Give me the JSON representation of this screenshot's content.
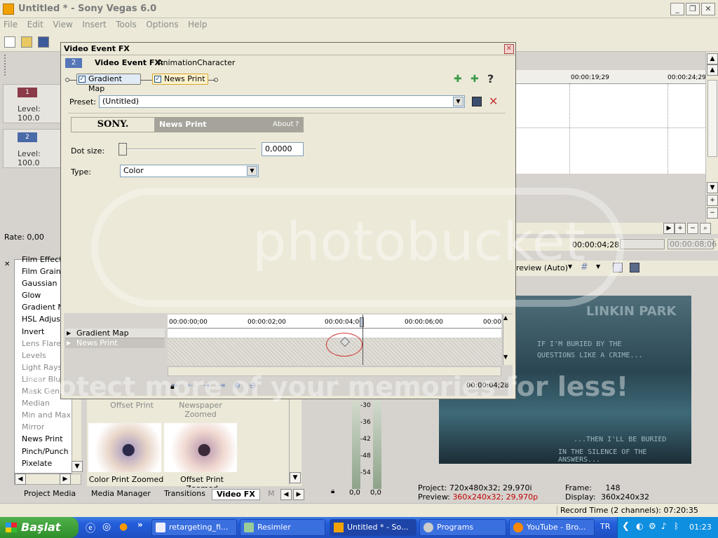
{
  "app": {
    "title": "Untitled * - Sony Vegas 6.0"
  },
  "menu": [
    "File",
    "Edit",
    "View",
    "Insert",
    "Tools",
    "Options",
    "Help"
  ],
  "tracks": [
    {
      "number": "1",
      "level": "Level: 100.0"
    },
    {
      "number": "2",
      "level": "Level: 100.0"
    }
  ],
  "rate": "Rate: 0,00",
  "timeline": {
    "ticks": [
      "00:00:19;29",
      "00:00:24;29"
    ],
    "cursor": "00:00:04;28",
    "end": "00:00:08;06"
  },
  "dialog": {
    "title": "Video Event FX",
    "subtitle_bold": "Video Event FX:",
    "subtitle_value": "AnimationCharacter",
    "track_badge": "2",
    "chain": [
      "Gradient Map",
      "News Print"
    ],
    "preset_label": "Preset:",
    "preset_value": "(Untitled)",
    "sony_logo": "SONY.",
    "plugin_name": "News Print",
    "about": "About",
    "about_q": "?",
    "help": "?",
    "dot_size_label": "Dot size:",
    "dot_size_value": "0,0000",
    "type_label": "Type:",
    "type_value": "Color",
    "kf_tracks": [
      "Gradient Map",
      "News Print"
    ],
    "kf_ticks": [
      "00:00:00;00",
      "00:00:02;00",
      "00:00:04;00",
      "00:00:06;00",
      "00:00"
    ],
    "kf_time": "00:00:04;28"
  },
  "fx_list": [
    {
      "label": "Film Effects",
      "dim": false
    },
    {
      "label": "Film Grain",
      "dim": false
    },
    {
      "label": "Gaussian Bl",
      "dim": false
    },
    {
      "label": "Glow",
      "dim": false
    },
    {
      "label": "Gradient Ma",
      "dim": false
    },
    {
      "label": "HSL Adjust",
      "dim": false
    },
    {
      "label": "Invert",
      "dim": false
    },
    {
      "label": "Lens Flare",
      "dim": true
    },
    {
      "label": "Levels",
      "dim": true
    },
    {
      "label": "Light Rays",
      "dim": true
    },
    {
      "label": "Linear Blur",
      "dim": true
    },
    {
      "label": "Mask Gener",
      "dim": true
    },
    {
      "label": "Median",
      "dim": true
    },
    {
      "label": "Min and Max",
      "dim": true
    },
    {
      "label": "Mirror",
      "dim": true
    },
    {
      "label": "News Print",
      "dim": false
    },
    {
      "label": "Pinch/Punch",
      "dim": false
    },
    {
      "label": "Pixelate",
      "dim": false
    }
  ],
  "presets": {
    "top": [
      "Offset Print",
      "Newspaper Zoomed"
    ],
    "bottom": [
      "Color Print Zoomed",
      "Offset Print Zoomed"
    ]
  },
  "tabs": [
    "Project Media",
    "Media Manager",
    "Transitions",
    "Video FX",
    "M"
  ],
  "meter": {
    "ticks": [
      "-30",
      "-36",
      "-42",
      "-48",
      "-54"
    ],
    "left": "0,0",
    "right": "0,0"
  },
  "preview": {
    "mode": "review (Auto)",
    "project_label": "Project:",
    "project_value": "720x480x32; 29,970i",
    "preview_label": "Preview:",
    "preview_value": "360x240x32; 29,970p",
    "frame_label": "Frame:",
    "frame_value": "148",
    "display_label": "Display:",
    "display_value": "360x240x32",
    "image_title": "LINKIN PARK",
    "lyric1": "IF I'M BURIED BY THE",
    "lyric2": "QUESTIONS LIKE A CRIME...",
    "lyric3": "...THEN I'LL BE BURIED",
    "lyric4": "IN THE SILENCE OF THE ANSWERS..."
  },
  "status": "Record Time (2 channels): 07:20:35",
  "taskbar": {
    "start": "Başlat",
    "tasks": [
      "retargeting_fi...",
      "Resimler",
      "Untitled * - So...",
      "Programs",
      "YouTube - Bro..."
    ],
    "lang": "TR",
    "clock": "01:23"
  },
  "watermark": {
    "main": "photobucket",
    "sub": "Protect more of your memories for less!"
  },
  "colors": {
    "accent": "#2f5fb8",
    "taskbar": "#245edb",
    "start": "#3b9d36",
    "selection": "#e3b048"
  }
}
